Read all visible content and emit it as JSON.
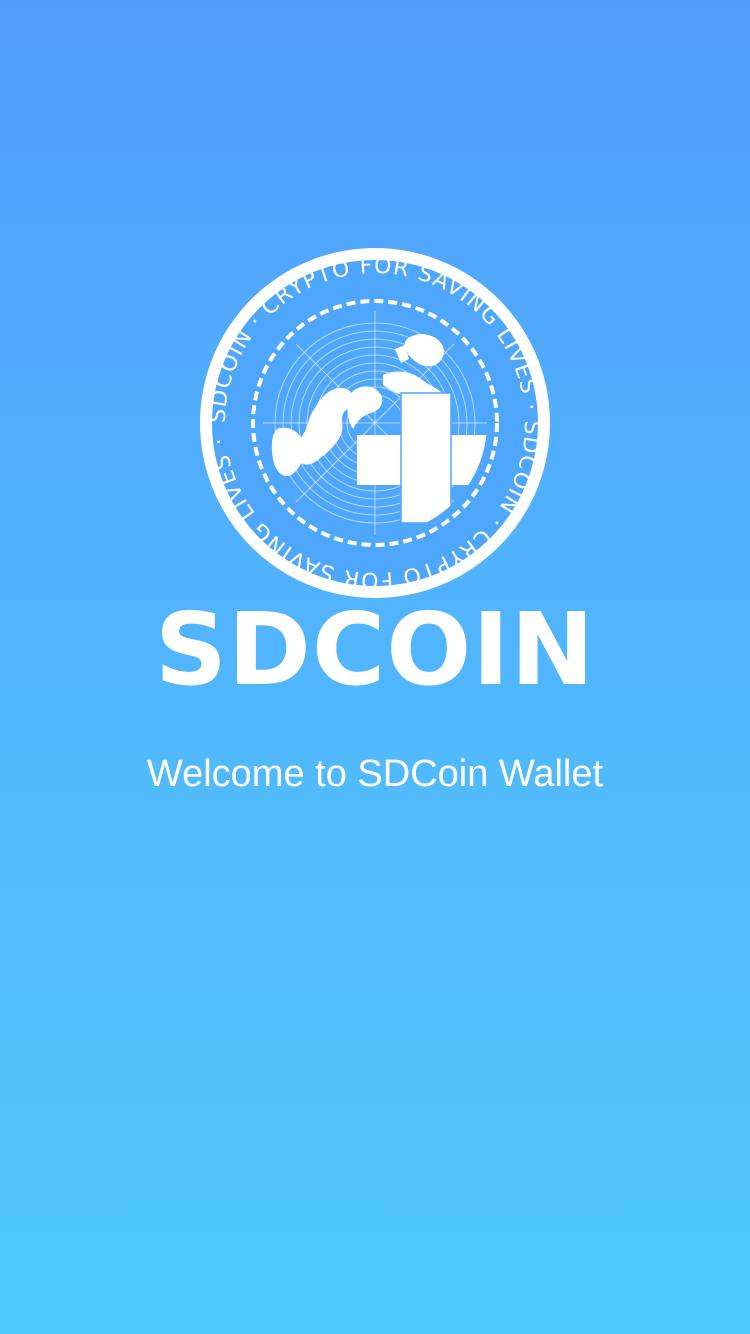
{
  "splash": {
    "logo": {
      "ring_text": "SDCOIN · CRYPTO FOR SAVING LIVES · SDCOIN · CRYPTO FOR SAVING LIVES ·",
      "icon": "sdcoin-globe-cross-icon"
    },
    "brand_name": "SDCOIN",
    "welcome_text": "Welcome to SDCoin Wallet"
  },
  "colors": {
    "background_top": "#519dfe",
    "background_bottom": "#50cafc",
    "foreground": "#ffffff"
  }
}
